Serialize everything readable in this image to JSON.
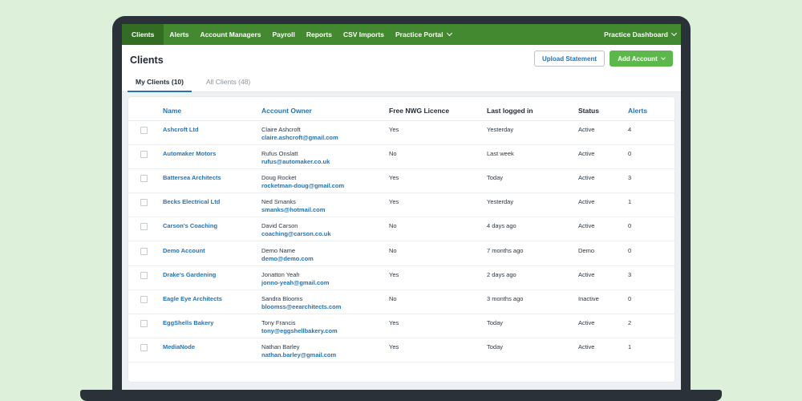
{
  "nav": {
    "items": [
      {
        "label": "Clients",
        "active": true
      },
      {
        "label": "Alerts"
      },
      {
        "label": "Account Managers"
      },
      {
        "label": "Payroll"
      },
      {
        "label": "Reports"
      },
      {
        "label": "CSV Imports"
      },
      {
        "label": "Practice Portal",
        "dropdown": true
      }
    ],
    "right": {
      "label": "Practice Dashboard",
      "dropdown": true
    }
  },
  "page": {
    "title": "Clients",
    "upload_label": "Upload Statement",
    "add_label": "Add Account"
  },
  "tabs": [
    {
      "label": "My Clients (10)",
      "active": true
    },
    {
      "label": "All Clients (48)",
      "active": false
    }
  ],
  "table": {
    "columns": [
      "Name",
      "Account Owner",
      "Free NWG Licence",
      "Last logged in",
      "Status",
      "Alerts"
    ],
    "rows": [
      {
        "name": "Ashcroft Ltd",
        "owner": "Claire Ashcroft",
        "email": "claire.ashcroft@gmail.com",
        "licence": "Yes",
        "last": "Yesterday",
        "status": "Active",
        "alerts": "4"
      },
      {
        "name": "Automaker Motors",
        "owner": "Rufus Onslatt",
        "email": "rufus@automaker.co.uk",
        "licence": "No",
        "last": "Last week",
        "status": "Active",
        "alerts": "0"
      },
      {
        "name": "Battersea Architects",
        "owner": "Doug Rocket",
        "email": "rocketman-doug@gmail.com",
        "licence": "Yes",
        "last": "Today",
        "status": "Active",
        "alerts": "3"
      },
      {
        "name": "Becks Electrical Ltd",
        "owner": "Ned Smanks",
        "email": "smanks@hotmail.com",
        "licence": "Yes",
        "last": "Yesterday",
        "status": "Active",
        "alerts": "1"
      },
      {
        "name": "Carson's Coaching",
        "owner": "David Carson",
        "email": "coaching@carson.co.uk",
        "licence": "No",
        "last": "4 days ago",
        "status": "Active",
        "alerts": "0"
      },
      {
        "name": "Demo Account",
        "owner": "Demo Name",
        "email": "demo@demo.com",
        "licence": "No",
        "last": "7 months ago",
        "status": "Demo",
        "alerts": "0"
      },
      {
        "name": "Drake's Gardening",
        "owner": "Jonatton Yeah",
        "email": "jonno-yeah@gmail.com",
        "licence": "Yes",
        "last": "2 days ago",
        "status": "Active",
        "alerts": "3"
      },
      {
        "name": "Eagle Eye Architects",
        "owner": "Sandra Blooms",
        "email": "bloomss@eearchitects.com",
        "licence": "No",
        "last": "3 months ago",
        "status": "Inactive",
        "alerts": "0"
      },
      {
        "name": "EggShells Bakery",
        "owner": "Tony Francis",
        "email": "tony@eggshellbakery.com",
        "licence": "Yes",
        "last": "Today",
        "status": "Active",
        "alerts": "2"
      },
      {
        "name": "MediaNode",
        "owner": "Nathan Barley",
        "email": "nathan.barley@gmail.com",
        "licence": "Yes",
        "last": "Today",
        "status": "Active",
        "alerts": "1"
      }
    ]
  },
  "colors": {
    "nav_green": "#43892f",
    "nav_active": "#336d24",
    "add_button": "#5cb84a",
    "link_blue": "#2473b8",
    "background": "#ddf0d9"
  }
}
